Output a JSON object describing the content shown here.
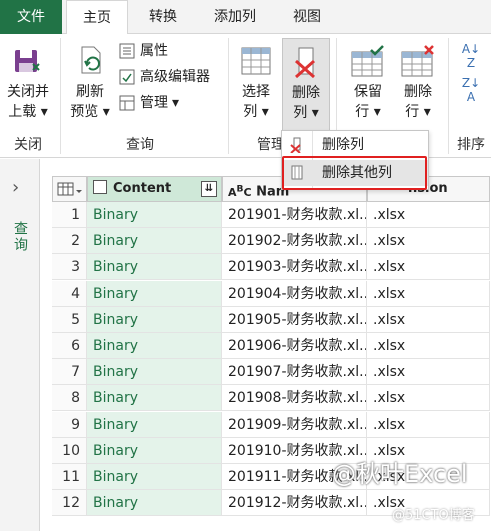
{
  "tabs": [
    "文件",
    "主页",
    "转换",
    "添加列",
    "视图"
  ],
  "ribbon": {
    "close_load": [
      "关闭并",
      "上载"
    ],
    "refresh": [
      "刷新",
      "预览"
    ],
    "properties": "属性",
    "advanced_editor": "高级编辑器",
    "manage": "管理",
    "choose_columns": [
      "选择",
      "列"
    ],
    "remove_columns": [
      "删除",
      "列"
    ],
    "keep_rows": [
      "保留",
      "行"
    ],
    "remove_rows": [
      "删除",
      "行"
    ],
    "group_close": "关闭",
    "group_query": "查询",
    "group_manage": "管理",
    "group_sort": "排序"
  },
  "dropdown": {
    "items": [
      "删除列",
      "删除其他列"
    ]
  },
  "query_pane": {
    "label": "查询"
  },
  "table": {
    "headers": [
      "Content",
      "Name",
      ".extension"
    ],
    "header_name_visible": "Nam",
    "header_ext_visible": "nsion",
    "rows": [
      {
        "idx": "1",
        "content": "Binary",
        "name": "201901-财务收款.xl...",
        "ext": ".xlsx"
      },
      {
        "idx": "2",
        "content": "Binary",
        "name": "201902-财务收款.xl...",
        "ext": ".xlsx"
      },
      {
        "idx": "3",
        "content": "Binary",
        "name": "201903-财务收款.xl...",
        "ext": ".xlsx"
      },
      {
        "idx": "4",
        "content": "Binary",
        "name": "201904-财务收款.xl...",
        "ext": ".xlsx"
      },
      {
        "idx": "5",
        "content": "Binary",
        "name": "201905-财务收款.xl...",
        "ext": ".xlsx"
      },
      {
        "idx": "6",
        "content": "Binary",
        "name": "201906-财务收款.xl...",
        "ext": ".xlsx"
      },
      {
        "idx": "7",
        "content": "Binary",
        "name": "201907-财务收款.xl...",
        "ext": ".xlsx"
      },
      {
        "idx": "8",
        "content": "Binary",
        "name": "201908-财务收款.xl...",
        "ext": ".xlsx"
      },
      {
        "idx": "9",
        "content": "Binary",
        "name": "201909-财务收款.xl...",
        "ext": ".xlsx"
      },
      {
        "idx": "10",
        "content": "Binary",
        "name": "201910-财务收款.xl...",
        "ext": ".xlsx"
      },
      {
        "idx": "11",
        "content": "Binary",
        "name": "201911-财务收款.xl...",
        "ext": ".xlsx"
      },
      {
        "idx": "12",
        "content": "Binary",
        "name": "201912-财务收款.xl...",
        "ext": ".xlsx"
      }
    ]
  },
  "watermark": "@秋叶Excel",
  "watermark_small": "@51CTO博客",
  "colors": {
    "accent": "#217346",
    "highlight_border": "#e02020",
    "content_bg": "#e4f3ea"
  }
}
